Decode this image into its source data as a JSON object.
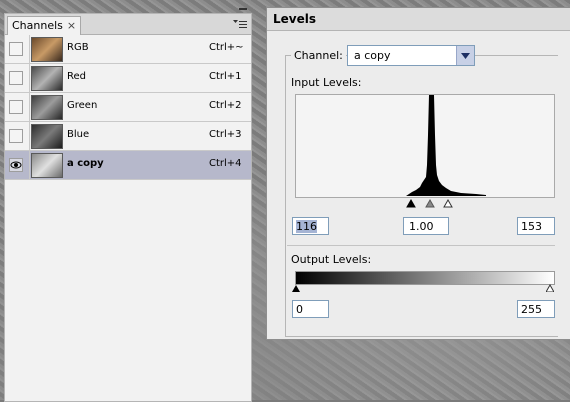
{
  "channels_panel": {
    "tab_label": "Channels",
    "rows": [
      {
        "name": "RGB",
        "shortcut": "Ctrl+~",
        "visible": false,
        "selected": false
      },
      {
        "name": "Red",
        "shortcut": "Ctrl+1",
        "visible": false,
        "selected": false
      },
      {
        "name": "Green",
        "shortcut": "Ctrl+2",
        "visible": false,
        "selected": false
      },
      {
        "name": "Blue",
        "shortcut": "Ctrl+3",
        "visible": false,
        "selected": false
      },
      {
        "name": "a copy",
        "shortcut": "Ctrl+4",
        "visible": true,
        "selected": true
      }
    ]
  },
  "levels_dialog": {
    "title": "Levels",
    "channel_label": "Channel:",
    "channel_value": "a copy",
    "input_levels_label": "Input Levels:",
    "input_black": "116",
    "input_gamma": "1.00",
    "input_white": "153",
    "output_levels_label": "Output Levels:",
    "output_black": "0",
    "output_white": "255"
  },
  "colors": {
    "selected_row": "#b6b8cb",
    "field_border": "#7f9db9",
    "highlight": "#a5b4d4"
  }
}
